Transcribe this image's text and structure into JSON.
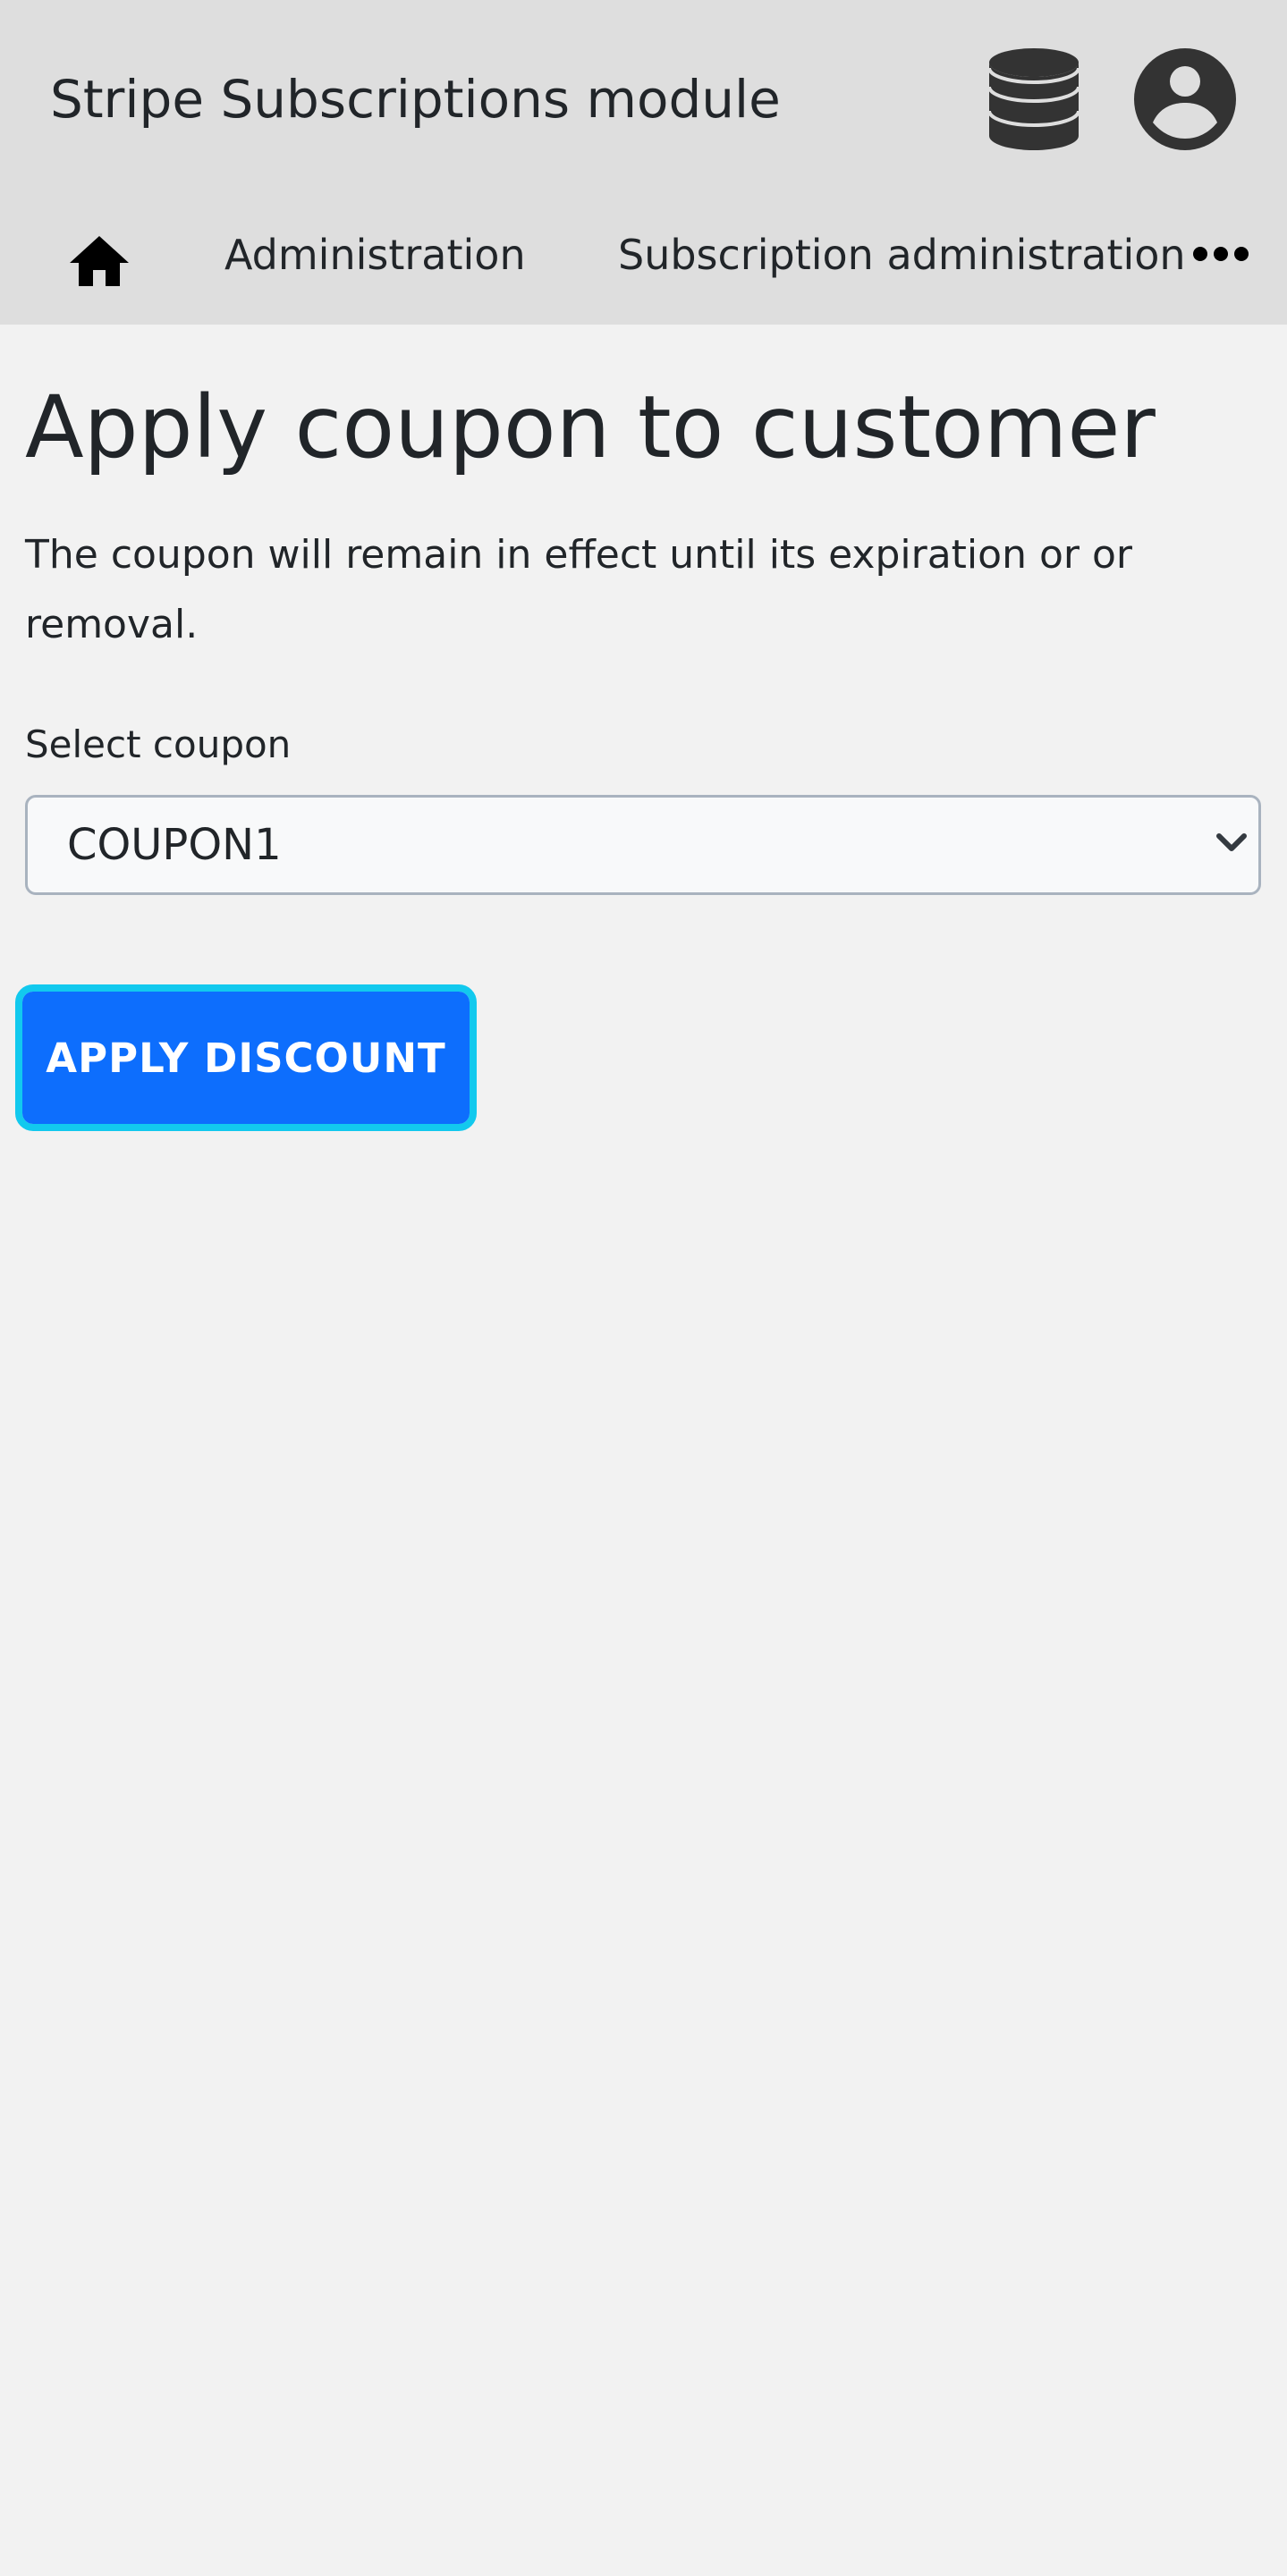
{
  "header": {
    "app_title": "Stripe Subscriptions module",
    "icons": {
      "database": "database-icon",
      "user": "user-account-icon"
    }
  },
  "nav": {
    "home_icon": "home-icon",
    "items": [
      {
        "label": "Administration"
      },
      {
        "label": "Subscription administration"
      }
    ],
    "more_icon": "more-horizontal-icon"
  },
  "main": {
    "title": "Apply coupon to customer",
    "description": "The coupon will remain in effect until its expiration or or removal.",
    "coupon_field": {
      "label": "Select coupon",
      "selected_value": "COUPON1"
    },
    "apply_button_label": "APPLY DISCOUNT"
  },
  "colors": {
    "header_bg": "#dedede",
    "page_bg": "#f2f2f2",
    "primary": "#0d6efd",
    "focus_ring": "#12c9ee",
    "icon_dark": "#333333"
  }
}
